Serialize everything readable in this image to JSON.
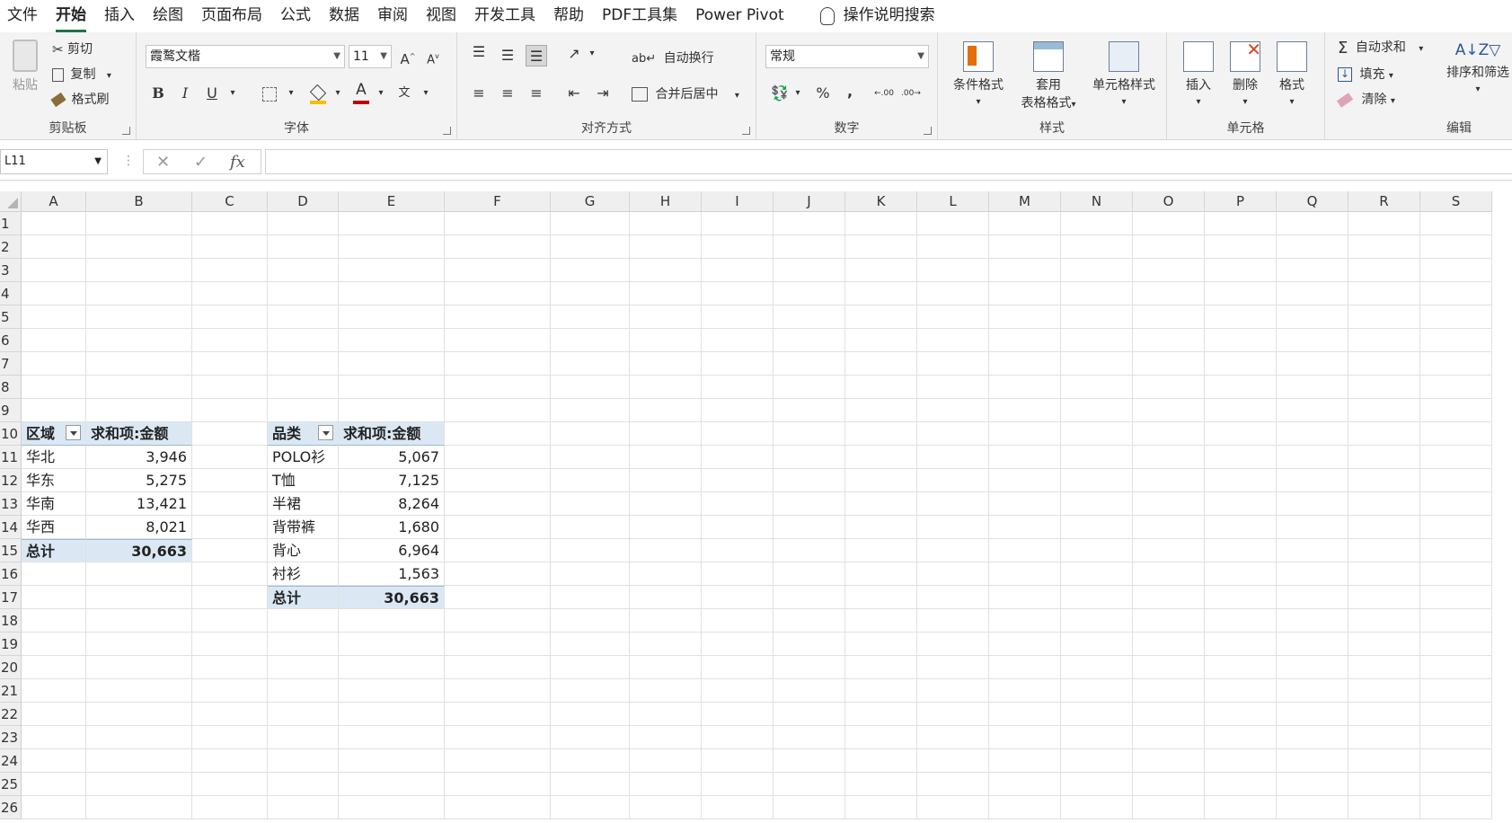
{
  "menu": {
    "tabs": [
      "文件",
      "开始",
      "插入",
      "绘图",
      "页面布局",
      "公式",
      "数据",
      "审阅",
      "视图",
      "开发工具",
      "帮助",
      "PDF工具集",
      "Power Pivot"
    ],
    "active_tab": "开始",
    "tell_me": "操作说明搜索"
  },
  "ribbon": {
    "clipboard": {
      "paste": "粘贴",
      "cut": "剪切",
      "copy": "复制",
      "format_painter": "格式刷",
      "label": "剪贴板"
    },
    "font": {
      "family": "霞鹜文楷",
      "size": "11",
      "grow": "A",
      "shrink": "A",
      "bold": "B",
      "italic": "I",
      "underline": "U",
      "phonetic": "文",
      "label": "字体"
    },
    "alignment": {
      "wrap": "自动换行",
      "merge": "合并后居中",
      "label": "对齐方式"
    },
    "number": {
      "format": "常规",
      "percent": "%",
      "comma": ",",
      "inc_dec": ".00",
      "label": "数字"
    },
    "styles": {
      "conditional": "条件格式",
      "table_line1": "套用",
      "table_line2": "表格格式",
      "cell_styles": "单元格样式",
      "label": "样式"
    },
    "cells": {
      "insert": "插入",
      "delete": "删除",
      "format": "格式",
      "label": "单元格"
    },
    "editing": {
      "autosum": "自动求和",
      "fill": "填充",
      "clear": "清除",
      "sort_filter": "排序和筛选",
      "label": "编辑"
    }
  },
  "formula_bar": {
    "name_box": "L11",
    "fx": "fx",
    "cancel": "✕",
    "enter": "✓",
    "content": ""
  },
  "columns": [
    "A",
    "B",
    "C",
    "D",
    "E",
    "F",
    "G",
    "H",
    "I",
    "J",
    "K",
    "L",
    "M",
    "N",
    "O",
    "P",
    "Q",
    "R",
    "S"
  ],
  "rows": [
    "1",
    "2",
    "3",
    "4",
    "5",
    "6",
    "7",
    "8",
    "9",
    "10",
    "11",
    "12",
    "13",
    "14",
    "15",
    "16",
    "17",
    "18",
    "19",
    "20",
    "21",
    "22",
    "23",
    "24",
    "25",
    "26"
  ],
  "pivot_region": {
    "header": [
      "区域",
      "求和项:金额"
    ],
    "rows": [
      [
        "华北",
        "3,946"
      ],
      [
        "华东",
        "5,275"
      ],
      [
        "华南",
        "13,421"
      ],
      [
        "华西",
        "8,021"
      ]
    ],
    "total": [
      "总计",
      "30,663"
    ]
  },
  "pivot_category": {
    "header": [
      "品类",
      "求和项:金额"
    ],
    "rows": [
      [
        "POLO衫",
        "5,067"
      ],
      [
        "T恤",
        "7,125"
      ],
      [
        "半裙",
        "8,264"
      ],
      [
        "背带裤",
        "1,680"
      ],
      [
        "背心",
        "6,964"
      ],
      [
        "衬衫",
        "1,563"
      ]
    ],
    "total": [
      "总计",
      "30,663"
    ]
  },
  "colors": {
    "accent": "#217346",
    "pivot_fill": "#dbe8f4",
    "ribbon_bg": "#f3f3f3"
  }
}
